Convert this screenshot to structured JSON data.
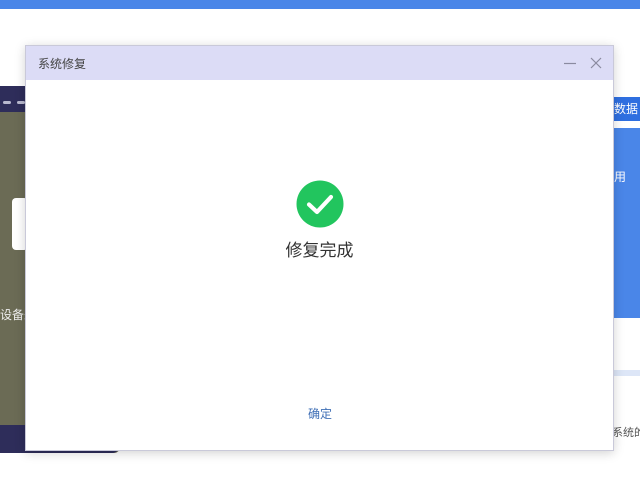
{
  "dialog": {
    "title": "系统修复",
    "status_text": "修复完成",
    "confirm_label": "确定"
  },
  "background": {
    "right_button_label": "数据",
    "right_panel_label": "用",
    "right_bottom_text": "系统的",
    "left_text": "设备未"
  },
  "colors": {
    "accent": "#4a86e8",
    "titlebar": "#dcdcf6",
    "success": "#22c55e",
    "link": "#3f6fb6"
  },
  "icons": {
    "minimize": "minimize-icon",
    "close": "close-icon",
    "success": "check-circle-icon"
  }
}
